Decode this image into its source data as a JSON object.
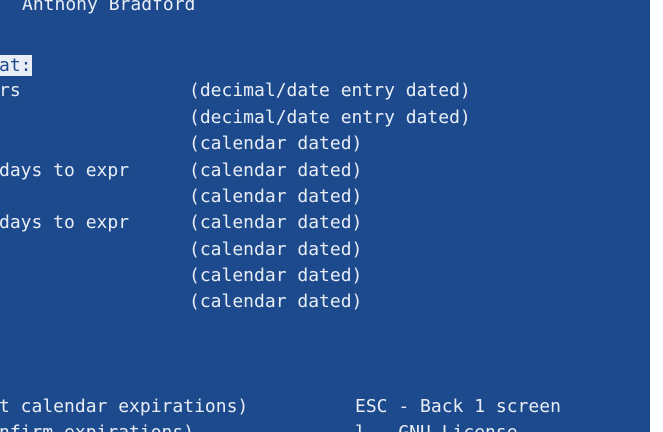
{
  "colors": {
    "background": "#1c4a8c",
    "foreground": "#e9eef6",
    "page": "#ffffff"
  },
  "terminal": {
    "header_name": "Anthony Bradford",
    "prompt_label": "at:",
    "rows": [
      {
        "left": "rs",
        "right": "(decimal/date entry dated)"
      },
      {
        "left": "",
        "right": "(decimal/date entry dated)"
      },
      {
        "left": "",
        "right": "(calendar dated)"
      },
      {
        "left": "days to expr",
        "right": "(calendar dated)"
      },
      {
        "left": "",
        "right": "(calendar dated)"
      },
      {
        "left": "days to expr",
        "right": "(calendar dated)"
      },
      {
        "left": "",
        "right": "(calendar dated)"
      },
      {
        "left": "",
        "right": "(calendar dated)"
      },
      {
        "left": "",
        "right": "(calendar dated)"
      }
    ],
    "footer": [
      {
        "left": "t calendar expirations)",
        "right": "ESC - Back 1 screen"
      },
      {
        "left": "nfirm expirations)",
        "right": "l - GNU License"
      }
    ]
  }
}
